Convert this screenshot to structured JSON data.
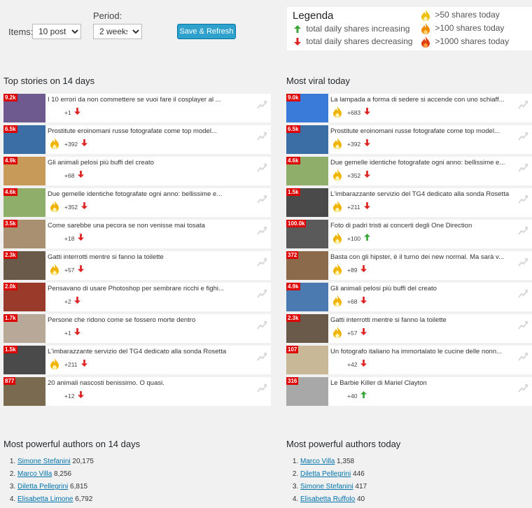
{
  "controls": {
    "items_label": "Items:",
    "items_value": "10 posts",
    "period_label": "Period:",
    "period_value": "2 weeks",
    "save_label": "Save & Refresh"
  },
  "legend": {
    "title": "Legenda",
    "increasing": "total daily shares increasing",
    "decreasing": "total daily shares decreasing",
    "gt50": ">50 shares today",
    "gt100": ">100 shares today",
    "gt1000": ">1000 shares today"
  },
  "left": {
    "title": "Top stories on 14 days",
    "items": [
      {
        "badge": "9.2k",
        "title": "I 10 errori da non commettere se vuoi fare il cosplayer al ...",
        "count": "+1",
        "dir": "down",
        "flame": "none",
        "thumb": "#6e5a8f"
      },
      {
        "badge": "6.5k",
        "title": "Prostitute eroinomani russe fotografate come top model...",
        "count": "+392",
        "dir": "down",
        "flame": "yellow",
        "thumb": "#3a6ea5"
      },
      {
        "badge": "4.9k",
        "title": "Gli animali pelosi più buffi del creato",
        "count": "+68",
        "dir": "down",
        "flame": "none",
        "thumb": "#c89a5a"
      },
      {
        "badge": "4.6k",
        "title": "Due gemelle identiche fotografate ogni anno: bellissime e...",
        "count": "+352",
        "dir": "down",
        "flame": "yellow",
        "thumb": "#8fae6a"
      },
      {
        "badge": "3.5k",
        "title": "Come sarebbe una pecora se non venisse mai tosata",
        "count": "+18",
        "dir": "down",
        "flame": "none",
        "thumb": "#a89070"
      },
      {
        "badge": "2.3k",
        "title": "Gatti interrotti mentre si fanno la toilette",
        "count": "+57",
        "dir": "down",
        "flame": "yellow",
        "thumb": "#6a5a4a"
      },
      {
        "badge": "2.0k",
        "title": "Pensavano di usare Photoshop per sembrare ricchi e fighi...",
        "count": "+2",
        "dir": "down",
        "flame": "none",
        "thumb": "#9a3a2a"
      },
      {
        "badge": "1.7k",
        "title": "Persone che ridono come se fossero morte dentro",
        "count": "+1",
        "dir": "down",
        "flame": "none",
        "thumb": "#b8a898"
      },
      {
        "badge": "1.5k",
        "title": "L'imbarazzante servizio del TG4 dedicato alla sonda Rosetta",
        "count": "+211",
        "dir": "down",
        "flame": "yellow",
        "thumb": "#4a4a4a"
      },
      {
        "badge": "877",
        "title": "20 animali nascosti benissimo. O quasi.",
        "count": "+12",
        "dir": "down",
        "flame": "none",
        "thumb": "#7a6a50"
      }
    ]
  },
  "right": {
    "title": "Most viral today",
    "items": [
      {
        "badge": "9.0k",
        "title": "La lampada a forma di sedere si accende con uno schiaff...",
        "count": "+683",
        "dir": "down",
        "flame": "yellow",
        "thumb": "#3a7ad8"
      },
      {
        "badge": "6.5k",
        "title": "Prostitute eroinomani russe fotografate come top model...",
        "count": "+392",
        "dir": "down",
        "flame": "yellow",
        "thumb": "#3a6ea5"
      },
      {
        "badge": "4.6k",
        "title": "Due gemelle identiche fotografate ogni anno: bellissime e...",
        "count": "+352",
        "dir": "down",
        "flame": "yellow",
        "thumb": "#8fae6a"
      },
      {
        "badge": "1.5k",
        "title": "L'imbarazzante servizio del TG4 dedicato alla sonda Rosetta",
        "count": "+211",
        "dir": "down",
        "flame": "yellow",
        "thumb": "#4a4a4a"
      },
      {
        "badge": "100.0k",
        "title": "Foto di padri tristi ai concerti degli One Direction",
        "count": "+100",
        "dir": "up",
        "flame": "yellow",
        "thumb": "#5a5a5a"
      },
      {
        "badge": "372",
        "title": "Basta con gli hipster, è il turno dei new normal. Ma sarà v...",
        "count": "+89",
        "dir": "down",
        "flame": "yellow",
        "thumb": "#8a6a4a"
      },
      {
        "badge": "4.9k",
        "title": "Gli animali pelosi più buffi del creato",
        "count": "+68",
        "dir": "down",
        "flame": "yellow",
        "thumb": "#4a7ab0"
      },
      {
        "badge": "2.3k",
        "title": "Gatti interrotti mentre si fanno la toilette",
        "count": "+57",
        "dir": "down",
        "flame": "yellow",
        "thumb": "#6a5a4a"
      },
      {
        "badge": "107",
        "title": "Un fotografo italiano ha immortalato le cucine delle nonn...",
        "count": "+42",
        "dir": "down",
        "flame": "none",
        "thumb": "#c8b898"
      },
      {
        "badge": "316",
        "title": "Le Barbie Killer di Mariel Clayton",
        "count": "+40",
        "dir": "up",
        "flame": "none",
        "thumb": "#a8a8a8"
      }
    ]
  },
  "authors_left": {
    "title": "Most powerful authors on 14 days",
    "items": [
      {
        "name": "Simone Stefanini",
        "value": "20,175"
      },
      {
        "name": "Marco Villa",
        "value": "8,256"
      },
      {
        "name": "Diletta Pellegrini",
        "value": "6,815"
      },
      {
        "name": "Elisabetta Limone",
        "value": "6,792"
      }
    ]
  },
  "authors_right": {
    "title": "Most powerful authors today",
    "items": [
      {
        "name": "Marco Villa",
        "value": "1,358"
      },
      {
        "name": "Diletta Pellegrini",
        "value": "446"
      },
      {
        "name": "Simone Stefanini",
        "value": "417"
      },
      {
        "name": "Elisabetta Ruffolo",
        "value": "40"
      }
    ]
  },
  "colors": {
    "badge": "#dd0000",
    "up": "#3aa63a",
    "down": "#dd2222",
    "flame_yellow": "#f0b400",
    "flame_orange": "#f08a00",
    "flame_red": "#e04010",
    "link": "#0073aa"
  }
}
